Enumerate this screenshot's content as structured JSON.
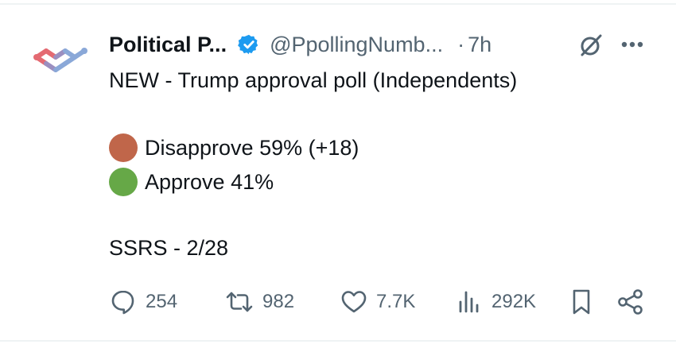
{
  "tweet": {
    "display_name": "Political P...",
    "handle": "@PpollingNumb...",
    "separator": "·",
    "time": "7h",
    "text_line_1": "NEW - Trump approval poll (Independents)",
    "poll": [
      {
        "label": "Disapprove 59% (+18)",
        "color": "#c0664a",
        "icon": "orange-circle-emoji"
      },
      {
        "label": "Approve 41%",
        "color": "#66a847",
        "icon": "green-circle-emoji"
      }
    ],
    "source_line": "SSRS - 2/28"
  },
  "actions": {
    "replies": "254",
    "reposts": "982",
    "likes": "7.7K",
    "views": "292K"
  },
  "colors": {
    "verified_blue": "#1d9bf0",
    "secondary_text": "#536471",
    "primary_text": "#0f1419",
    "avatar_red": "#e46a72",
    "avatar_blue": "#8aa8d8"
  },
  "icons": [
    "avatar-logo",
    "verified-badge-icon",
    "grok-icon",
    "more-options-icon",
    "reply-icon",
    "repost-icon",
    "like-icon",
    "views-icon",
    "bookmark-icon",
    "share-icon"
  ]
}
